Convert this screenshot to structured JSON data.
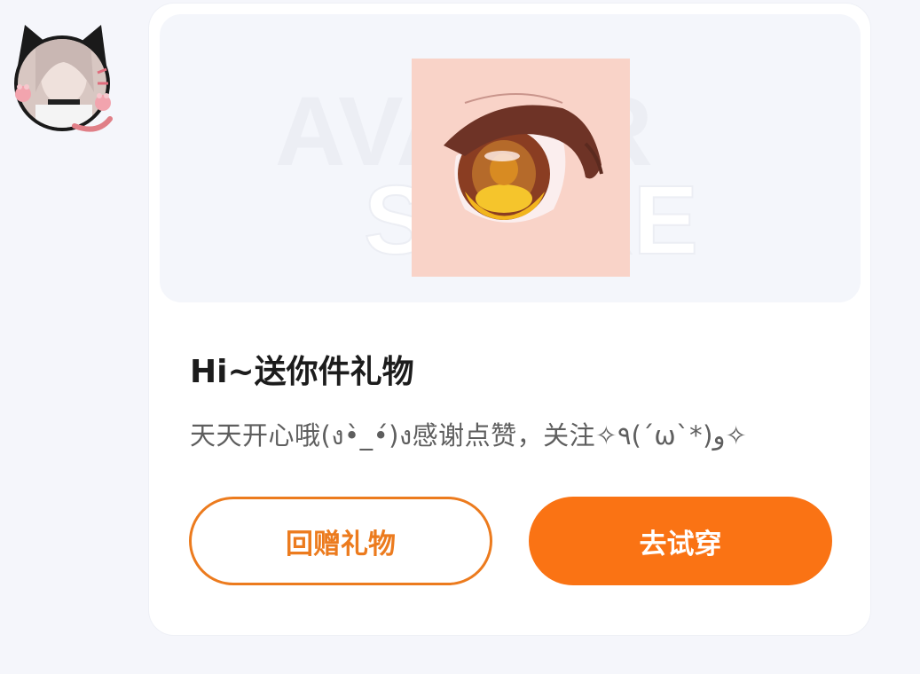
{
  "sender": {
    "avatar_icon": "user-avatar-cat-ears"
  },
  "gift_card": {
    "preview": {
      "watermark_line1": "AVATAR",
      "watermark_line2": "STORE",
      "item_icon": "anime-eye-item"
    },
    "title": "Hi~送你件礼物",
    "message": "天天开心哦(ง•̀_•́)ง感谢点赞，关注✧٩(ˊωˋ*)و✧",
    "buttons": {
      "return_gift": "回赠礼物",
      "try_on": "去试穿"
    }
  },
  "colors": {
    "accent": "#fa7314",
    "accent_outline": "#ec7b1e",
    "page_bg": "#f5f6fb",
    "preview_bg": "#f4f6fb",
    "item_bg": "#f9d3c8"
  }
}
